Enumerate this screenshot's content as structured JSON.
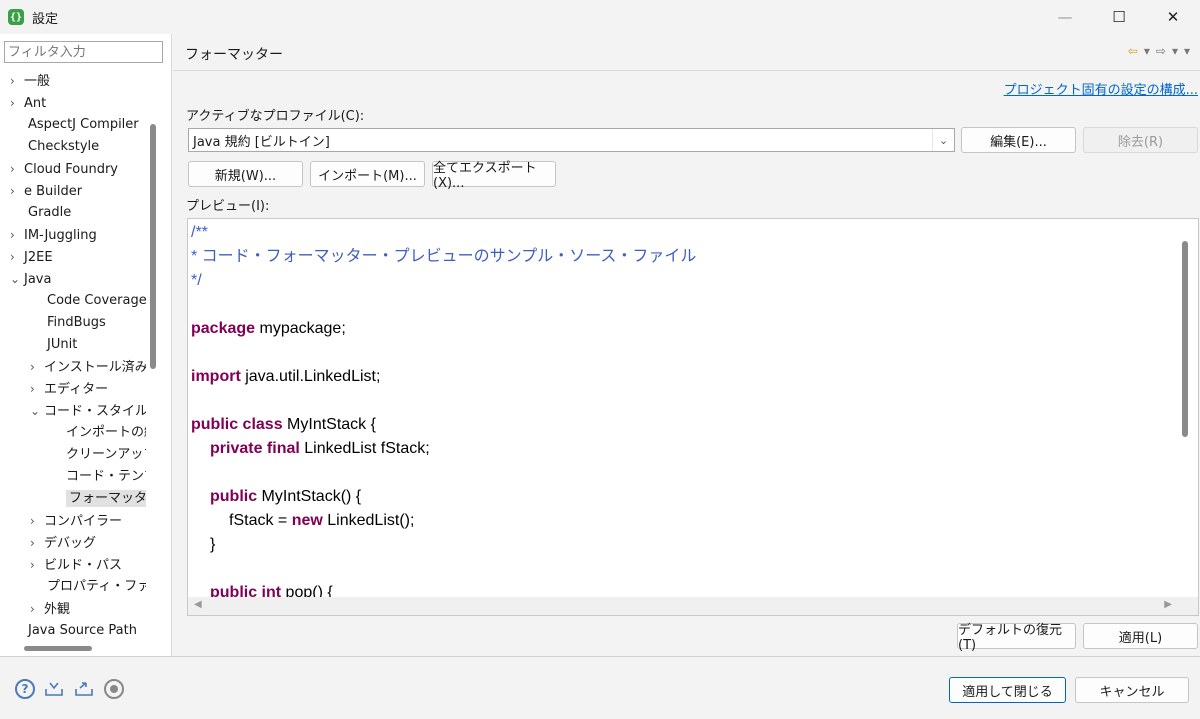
{
  "window": {
    "title": "設定",
    "minimize": "—",
    "maximize": "☐",
    "close": "✕"
  },
  "sidebar": {
    "filter_placeholder": "フィルタ入力",
    "items": [
      {
        "label": "一般",
        "expander": "›"
      },
      {
        "label": "Ant",
        "expander": "›"
      },
      {
        "label": "AspectJ Compiler",
        "expander": ""
      },
      {
        "label": "Checkstyle",
        "expander": ""
      },
      {
        "label": "Cloud Foundry",
        "expander": "›"
      },
      {
        "label": "e Builder",
        "expander": "›"
      },
      {
        "label": "Gradle",
        "expander": ""
      },
      {
        "label": "IM-Juggling",
        "expander": "›"
      },
      {
        "label": "J2EE",
        "expander": "›"
      },
      {
        "label": "Java",
        "expander": "⌄"
      },
      {
        "label": "Code Coverage",
        "expander": ""
      },
      {
        "label": "FindBugs",
        "expander": ""
      },
      {
        "label": "JUnit",
        "expander": ""
      },
      {
        "label": "インストール済みの",
        "expander": "›"
      },
      {
        "label": "エディター",
        "expander": "›"
      },
      {
        "label": "コード・スタイル",
        "expander": "⌄"
      },
      {
        "label": "インポートの編",
        "expander": ""
      },
      {
        "label": "クリーンアップ",
        "expander": ""
      },
      {
        "label": "コード・テンプレ",
        "expander": ""
      },
      {
        "label": "フォーマッター",
        "expander": ""
      },
      {
        "label": "コンパイラー",
        "expander": "›"
      },
      {
        "label": "デバッグ",
        "expander": "›"
      },
      {
        "label": "ビルド・パス",
        "expander": "›"
      },
      {
        "label": "プロパティ・ファイル",
        "expander": ""
      },
      {
        "label": "外観",
        "expander": "›"
      },
      {
        "label": "Java Source Path",
        "expander": ""
      }
    ]
  },
  "main": {
    "page_title": "フォーマッター",
    "project_link": "プロジェクト固有の設定の構成...",
    "profile_label": "アクティブなプロファイル(C):",
    "profile_value": "Java 規約 [ビルトイン]",
    "edit_button": "編集(E)...",
    "remove_button": "除去(R)",
    "new_button": "新規(W)...",
    "import_button": "インポート(M)...",
    "export_all_button": "全てエクスポート(X)...",
    "preview_label": "プレビュー(I):",
    "restore_defaults_button": "デフォルトの復元(T)",
    "apply_button": "適用(L)"
  },
  "preview_code": [
    {
      "kw": "",
      "text": "/**",
      "comment": true
    },
    {
      "kw": "",
      "text": "* コード・フォーマッター・プレビューのサンプル・ソース・ファイル",
      "comment": true
    },
    {
      "kw": "",
      "text": "*/",
      "comment": true
    },
    {
      "kw": "",
      "text": "",
      "comment": false
    },
    {
      "kw": "package",
      "text": " mypackage;",
      "comment": false
    },
    {
      "kw": "",
      "text": "",
      "comment": false
    },
    {
      "kw": "import",
      "text": " java.util.LinkedList;",
      "comment": false
    },
    {
      "kw": "",
      "text": "",
      "comment": false
    },
    {
      "kw": "public class",
      "text": " MyIntStack {",
      "comment": false
    },
    {
      "kw": "private final",
      "text": " LinkedList fStack;",
      "comment": false
    },
    {
      "kw": "",
      "text": "",
      "comment": false
    },
    {
      "kw": "public",
      "text": " MyIntStack() {",
      "comment": false
    },
    {
      "pre": "fStack = ",
      "kw": "new",
      "text": " LinkedList();",
      "comment": false
    },
    {
      "kw": "",
      "text": "}",
      "comment": false
    },
    {
      "kw": "",
      "text": "",
      "comment": false
    },
    {
      "kw": "public int",
      "text": " pop() {",
      "comment": false
    }
  ],
  "footer": {
    "apply_close_button": "適用して閉じる",
    "cancel_button": "キャンセル",
    "help_icon": "?"
  }
}
